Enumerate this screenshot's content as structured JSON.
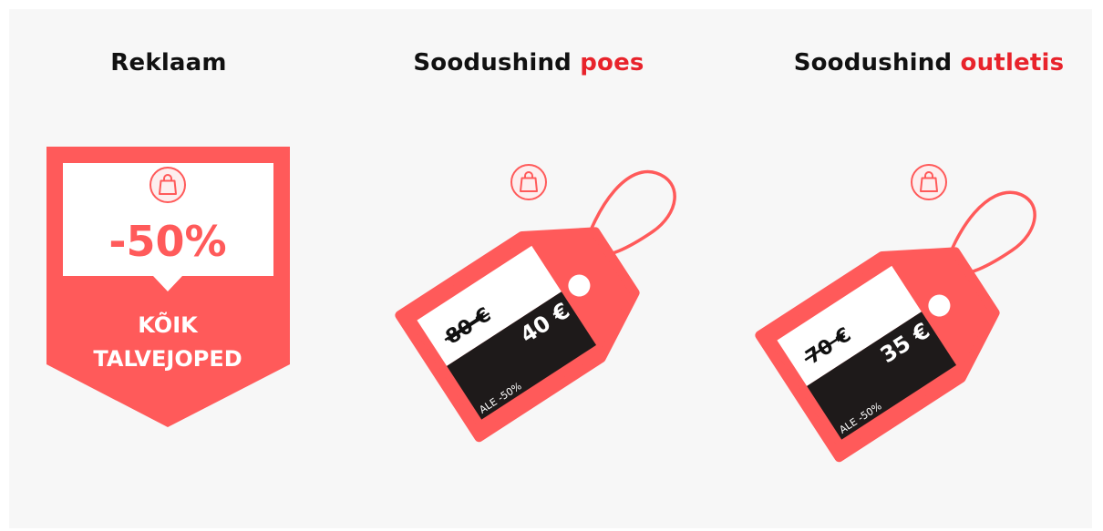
{
  "colors": {
    "background": "#f7f7f7",
    "accent": "#ff5a5a",
    "title_accent": "#e8232b",
    "dark": "#1e1a1a"
  },
  "columns": [
    {
      "title": "Reklaam",
      "title_accent": "",
      "icon": "shopping-bag-icon",
      "banner": {
        "discount": "-50%",
        "text_line1": "KÕIK",
        "text_line2": "TALVEJOPED"
      }
    },
    {
      "title": "Soodushind ",
      "title_accent": "poes",
      "icon": "shopping-bag-icon",
      "tag": {
        "old_price": "80 €",
        "new_price": "40 €",
        "label": "ALE -50%"
      }
    },
    {
      "title": "Soodushind ",
      "title_accent": "outletis",
      "icon": "shopping-bag-icon",
      "tag": {
        "old_price": "70 €",
        "new_price": "35 €",
        "label": "ALE -50%"
      }
    }
  ]
}
